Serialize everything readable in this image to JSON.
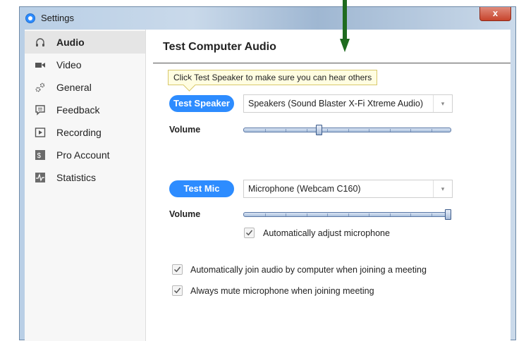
{
  "window": {
    "title": "Settings",
    "close_glyph": "x"
  },
  "sidebar": {
    "items": [
      {
        "label": "Audio",
        "icon": "headphones-icon",
        "active": true
      },
      {
        "label": "Video",
        "icon": "video-camera-icon",
        "active": false
      },
      {
        "label": "General",
        "icon": "gear-icon",
        "active": false
      },
      {
        "label": "Feedback",
        "icon": "chat-bubble-icon",
        "active": false
      },
      {
        "label": "Recording",
        "icon": "play-box-icon",
        "active": false
      },
      {
        "label": "Pro Account",
        "icon": "dollar-box-icon",
        "active": false
      },
      {
        "label": "Statistics",
        "icon": "pulse-icon",
        "active": false
      }
    ]
  },
  "main": {
    "title": "Test Computer Audio",
    "tooltip": "Click Test Speaker to make sure you can hear others",
    "speaker": {
      "button": "Test Speaker",
      "device": "Speakers (Sound Blaster X-Fi Xtreme Audio)",
      "volume_label": "Volume",
      "volume_fraction": 0.36
    },
    "mic": {
      "button": "Test Mic",
      "device": "Microphone (Webcam C160)",
      "volume_label": "Volume",
      "volume_fraction": 1.0,
      "auto_adjust_label": "Automatically adjust microphone",
      "auto_adjust_checked": true
    },
    "options": [
      {
        "label": "Automatically join audio by computer when joining a meeting",
        "checked": true
      },
      {
        "label": "Always mute microphone when joining meeting",
        "checked": true
      }
    ]
  },
  "colors": {
    "accent": "#2d8cff",
    "annotation_arrow": "#1f6b1f"
  }
}
